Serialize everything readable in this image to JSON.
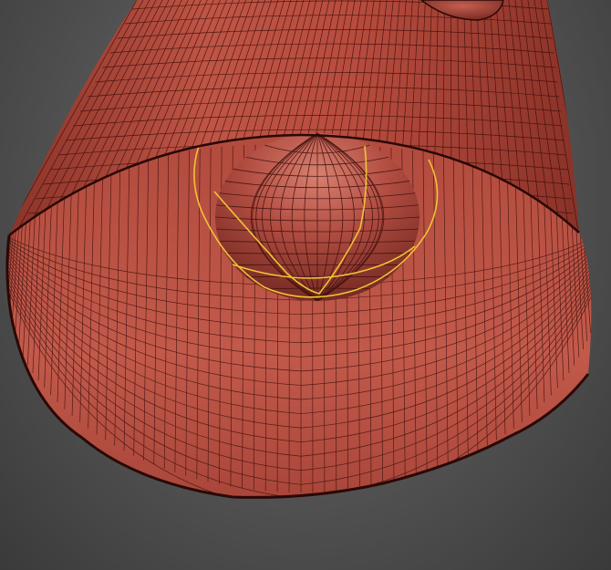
{
  "viewport": {
    "background_top": "#6a6a6a",
    "background_bottom": "#3b3b3b"
  },
  "scene": {
    "objects": [
      {
        "name": "cone-shell",
        "kind": "truncated-cone-mesh",
        "color": "#b04a3c"
      },
      {
        "name": "inner-sphere",
        "kind": "sphere-mesh",
        "color": "#a9473d"
      },
      {
        "name": "top-sphere-fragment",
        "kind": "sphere-mesh",
        "color": "#9e3f35"
      }
    ],
    "wire_color": "#3a0d0a",
    "selection_color": "#f2c234"
  }
}
